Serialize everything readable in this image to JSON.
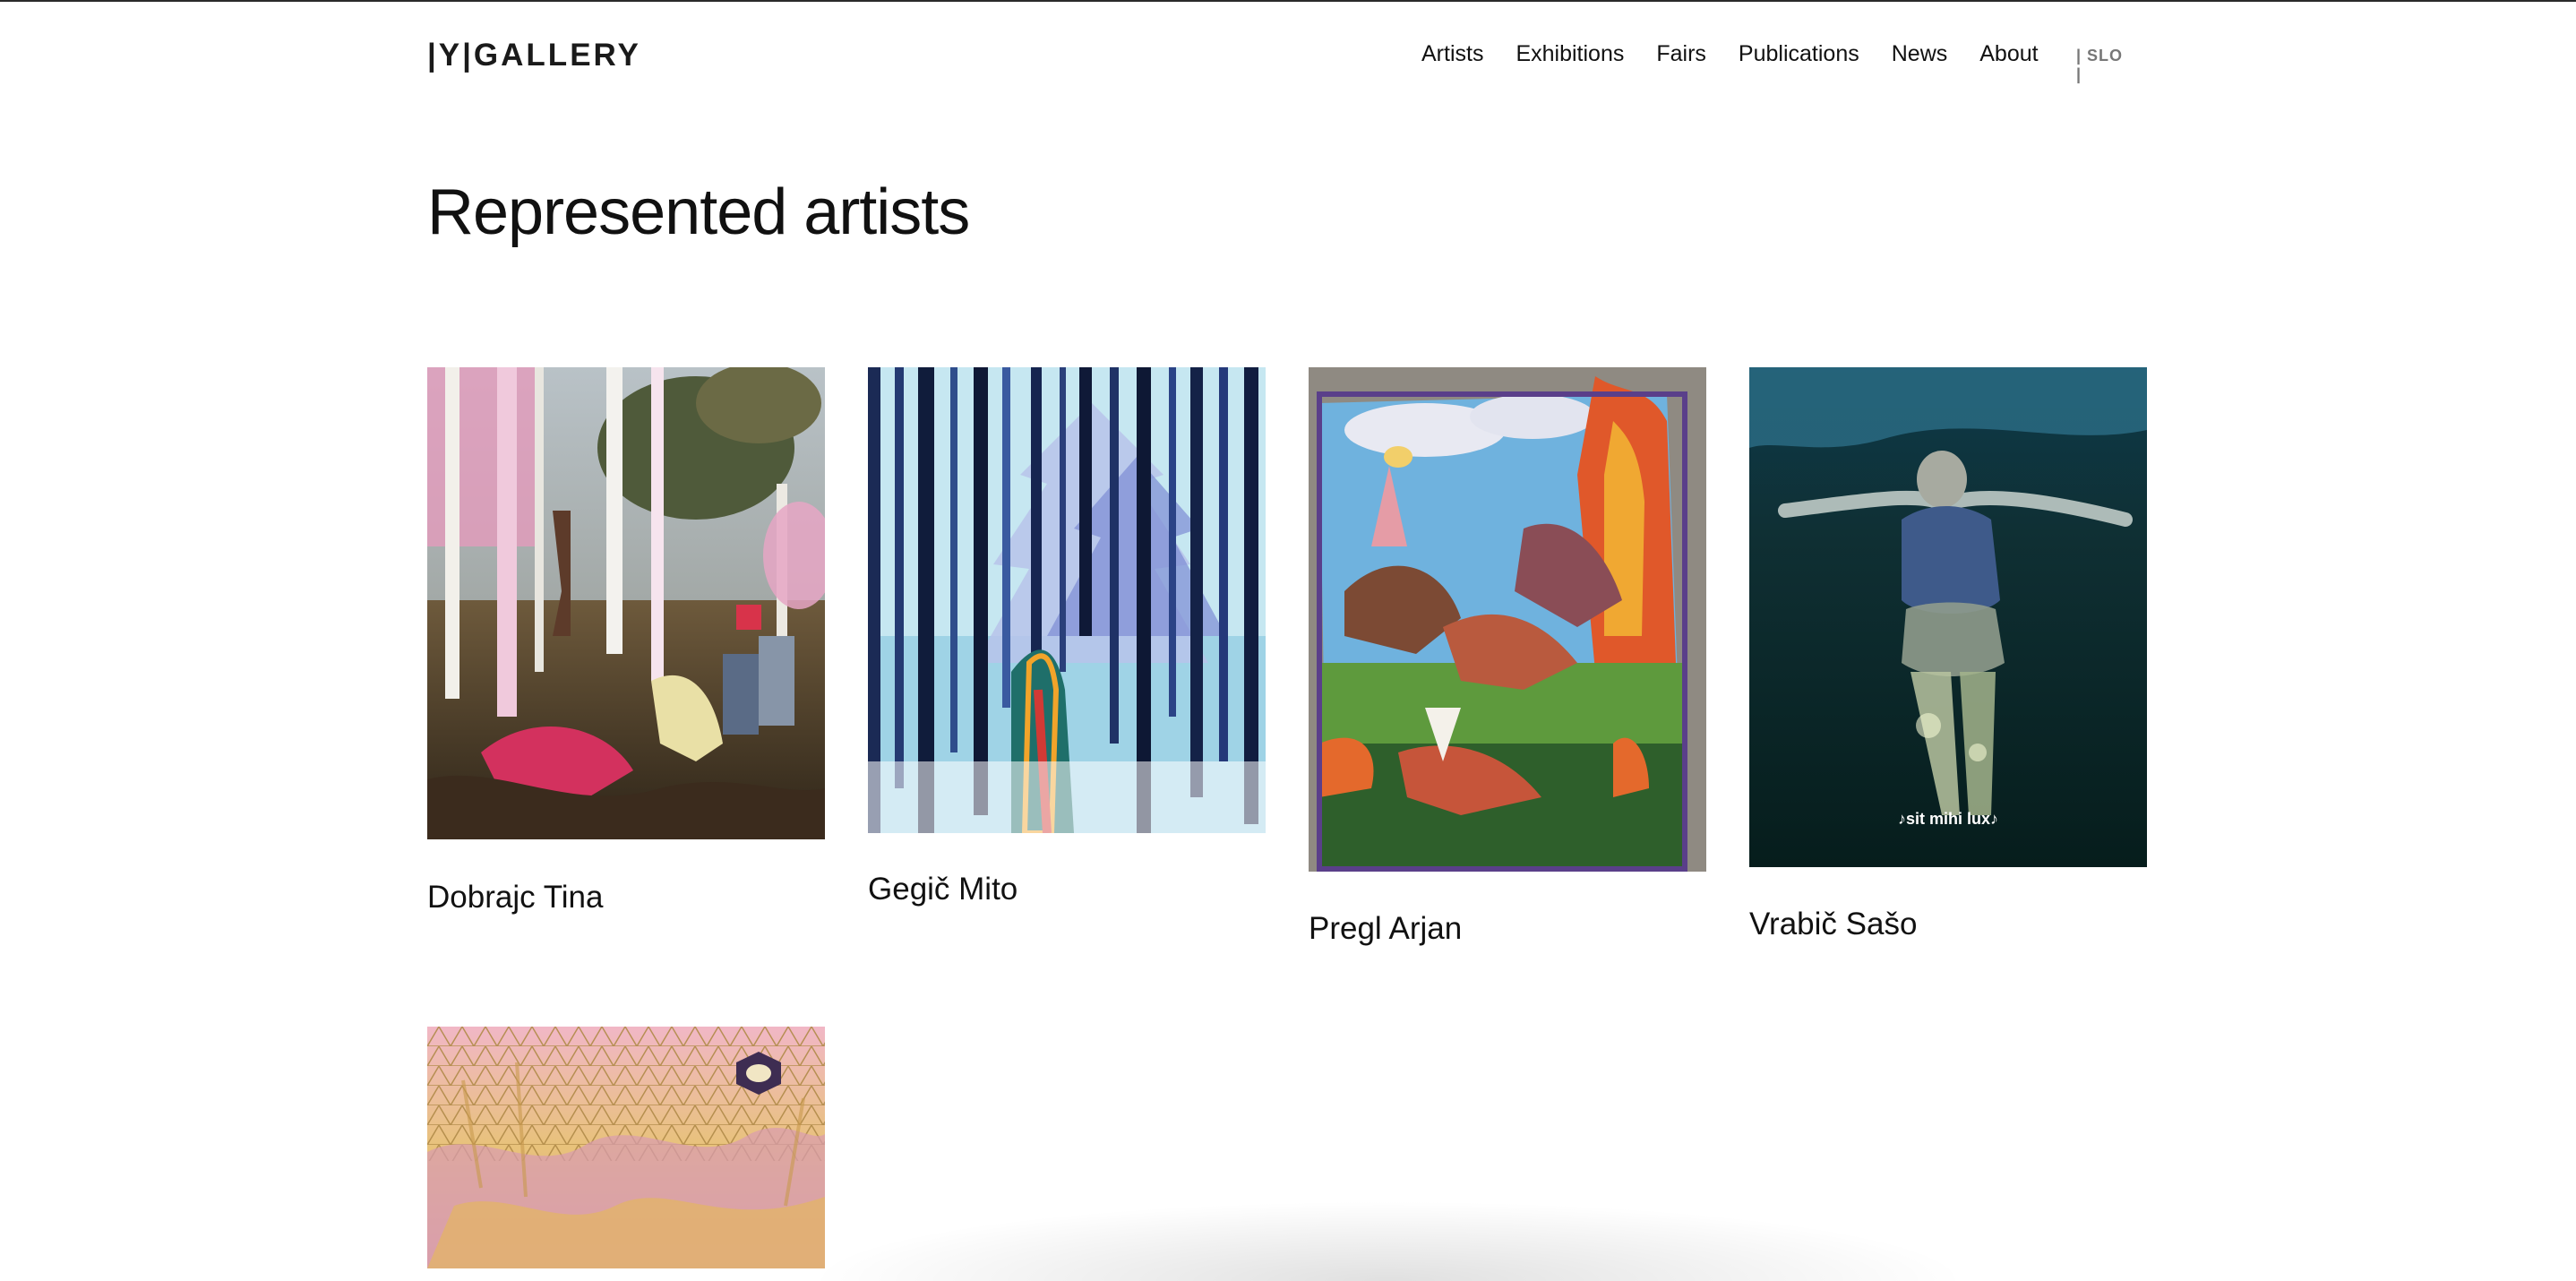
{
  "brand": {
    "logo": "|Y|GALLERY"
  },
  "nav": {
    "items": [
      "Artists",
      "Exhibitions",
      "Fairs",
      "Publications",
      "News",
      "About"
    ],
    "language": "| SLO |"
  },
  "page": {
    "title": "Represented artists"
  },
  "artists": [
    {
      "name": "Dobrajc Tina"
    },
    {
      "name": "Gegič Mito"
    },
    {
      "name": "Pregl Arjan"
    },
    {
      "name": "Vrabič Sašo",
      "artwork_caption": "♪sit mihi lux♪"
    },
    {
      "name": ""
    }
  ]
}
